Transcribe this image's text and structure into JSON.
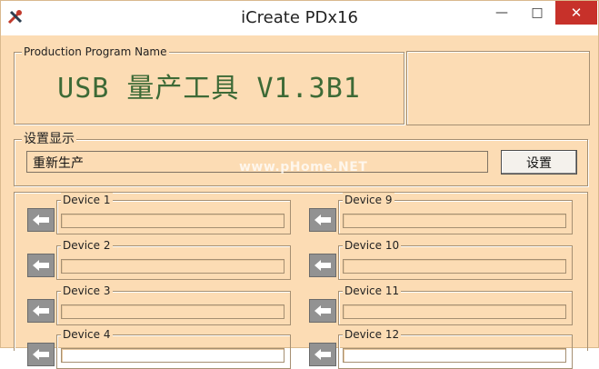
{
  "window": {
    "title": "iCreate PDx16",
    "minimize_symbol": "—",
    "maximize_symbol": "□",
    "close_symbol": "✕"
  },
  "production": {
    "group_label": "Production Program Name",
    "name": "USB 量产工具 V1.3B1"
  },
  "settings": {
    "group_label": "设置显示",
    "field_value": "重新生产",
    "button_label": "设置"
  },
  "watermark": "www.pHome.NET",
  "devices": {
    "left": [
      "Device 1",
      "Device 2",
      "Device 3",
      "Device 4"
    ],
    "right": [
      "Device 9",
      "Device 10",
      "Device 11",
      "Device 12"
    ]
  },
  "colors": {
    "window_bg": "#fcdcb4",
    "product_name": "#3d6a36",
    "close_button": "#c7312a",
    "arrow_button": "#929292"
  }
}
